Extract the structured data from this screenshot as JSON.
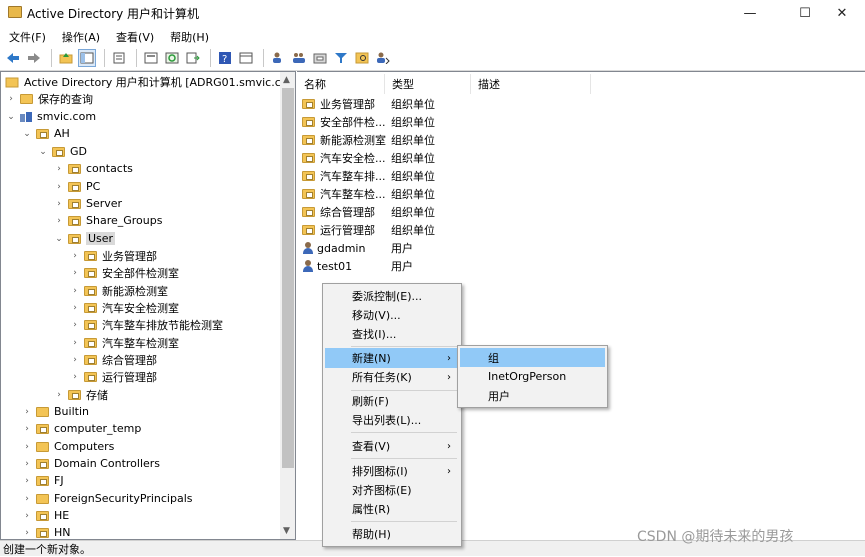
{
  "window": {
    "title": "Active Directory 用户和计算机",
    "minimize": "—",
    "maximize": "☐",
    "close": "✕"
  },
  "menubar": [
    "文件(F)",
    "操作(A)",
    "查看(V)",
    "帮助(H)"
  ],
  "toolbar": {
    "icons": [
      "back-arrow-icon",
      "forward-arrow-icon",
      "up-folder-icon",
      "console-tree-icon",
      "properties-icon",
      "export-icon",
      "refresh-icon",
      "export-list-icon",
      "help-icon",
      "show-pane-icon",
      "add-user-icon",
      "add-group-icon",
      "add-ou-icon",
      "filter-icon",
      "find-icon",
      "delegate-icon"
    ]
  },
  "tree": {
    "root": "Active Directory 用户和计算机 [ADRG01.smvic.com]",
    "saved_queries": "保存的查询",
    "domain": "smvic.com",
    "nodes": {
      "ah": "AH",
      "gd": "GD",
      "contacts": "contacts",
      "pc": "PC",
      "server": "Server",
      "share_groups": "Share_Groups",
      "user": "User",
      "user_children": [
        "业务管理部",
        "安全部件检测室",
        "新能源检测室",
        "汽车安全检测室",
        "汽车整车排放节能检测室",
        "汽车整车检测室",
        "综合管理部",
        "运行管理部"
      ],
      "storage": "存储",
      "builtin": "Builtin",
      "computer_temp": "computer_temp",
      "computers": "Computers",
      "domain_controllers": "Domain Controllers",
      "fj": "FJ",
      "foreign": "ForeignSecurityPrincipals",
      "he": "HE",
      "hn": "HN"
    }
  },
  "list": {
    "columns": [
      "名称",
      "类型",
      "描述"
    ],
    "rows": [
      {
        "name": "业务管理部",
        "type": "组织单位",
        "icon": "ou-folder-icon"
      },
      {
        "name": "安全部件检...",
        "type": "组织单位",
        "icon": "ou-folder-icon"
      },
      {
        "name": "新能源检测室",
        "type": "组织单位",
        "icon": "ou-folder-icon"
      },
      {
        "name": "汽车安全检...",
        "type": "组织单位",
        "icon": "ou-folder-icon"
      },
      {
        "name": "汽车整车排...",
        "type": "组织单位",
        "icon": "ou-folder-icon"
      },
      {
        "name": "汽车整车检...",
        "type": "组织单位",
        "icon": "ou-folder-icon"
      },
      {
        "name": "综合管理部",
        "type": "组织单位",
        "icon": "ou-folder-icon"
      },
      {
        "name": "运行管理部",
        "type": "组织单位",
        "icon": "ou-folder-icon"
      },
      {
        "name": "gdadmin",
        "type": "用户",
        "icon": "user-icon"
      },
      {
        "name": "test01",
        "type": "用户",
        "icon": "user-icon"
      }
    ]
  },
  "context_menu": {
    "items": [
      "委派控制(E)...",
      "移动(V)...",
      "查找(I)...",
      "新建(N)",
      "所有任务(K)",
      "刷新(F)",
      "导出列表(L)...",
      "查看(V)",
      "排列图标(I)",
      "对齐图标(E)",
      "属性(R)",
      "帮助(H)"
    ],
    "highlighted": "新建(N)"
  },
  "submenu": {
    "items": [
      "组",
      "InetOrgPerson",
      "用户"
    ],
    "highlighted": "组"
  },
  "status": "创建一个新对象。",
  "watermark": "CSDN @期待未来的男孩",
  "colors": {
    "highlight": "#91c9f7",
    "folder": "#f3c455"
  }
}
